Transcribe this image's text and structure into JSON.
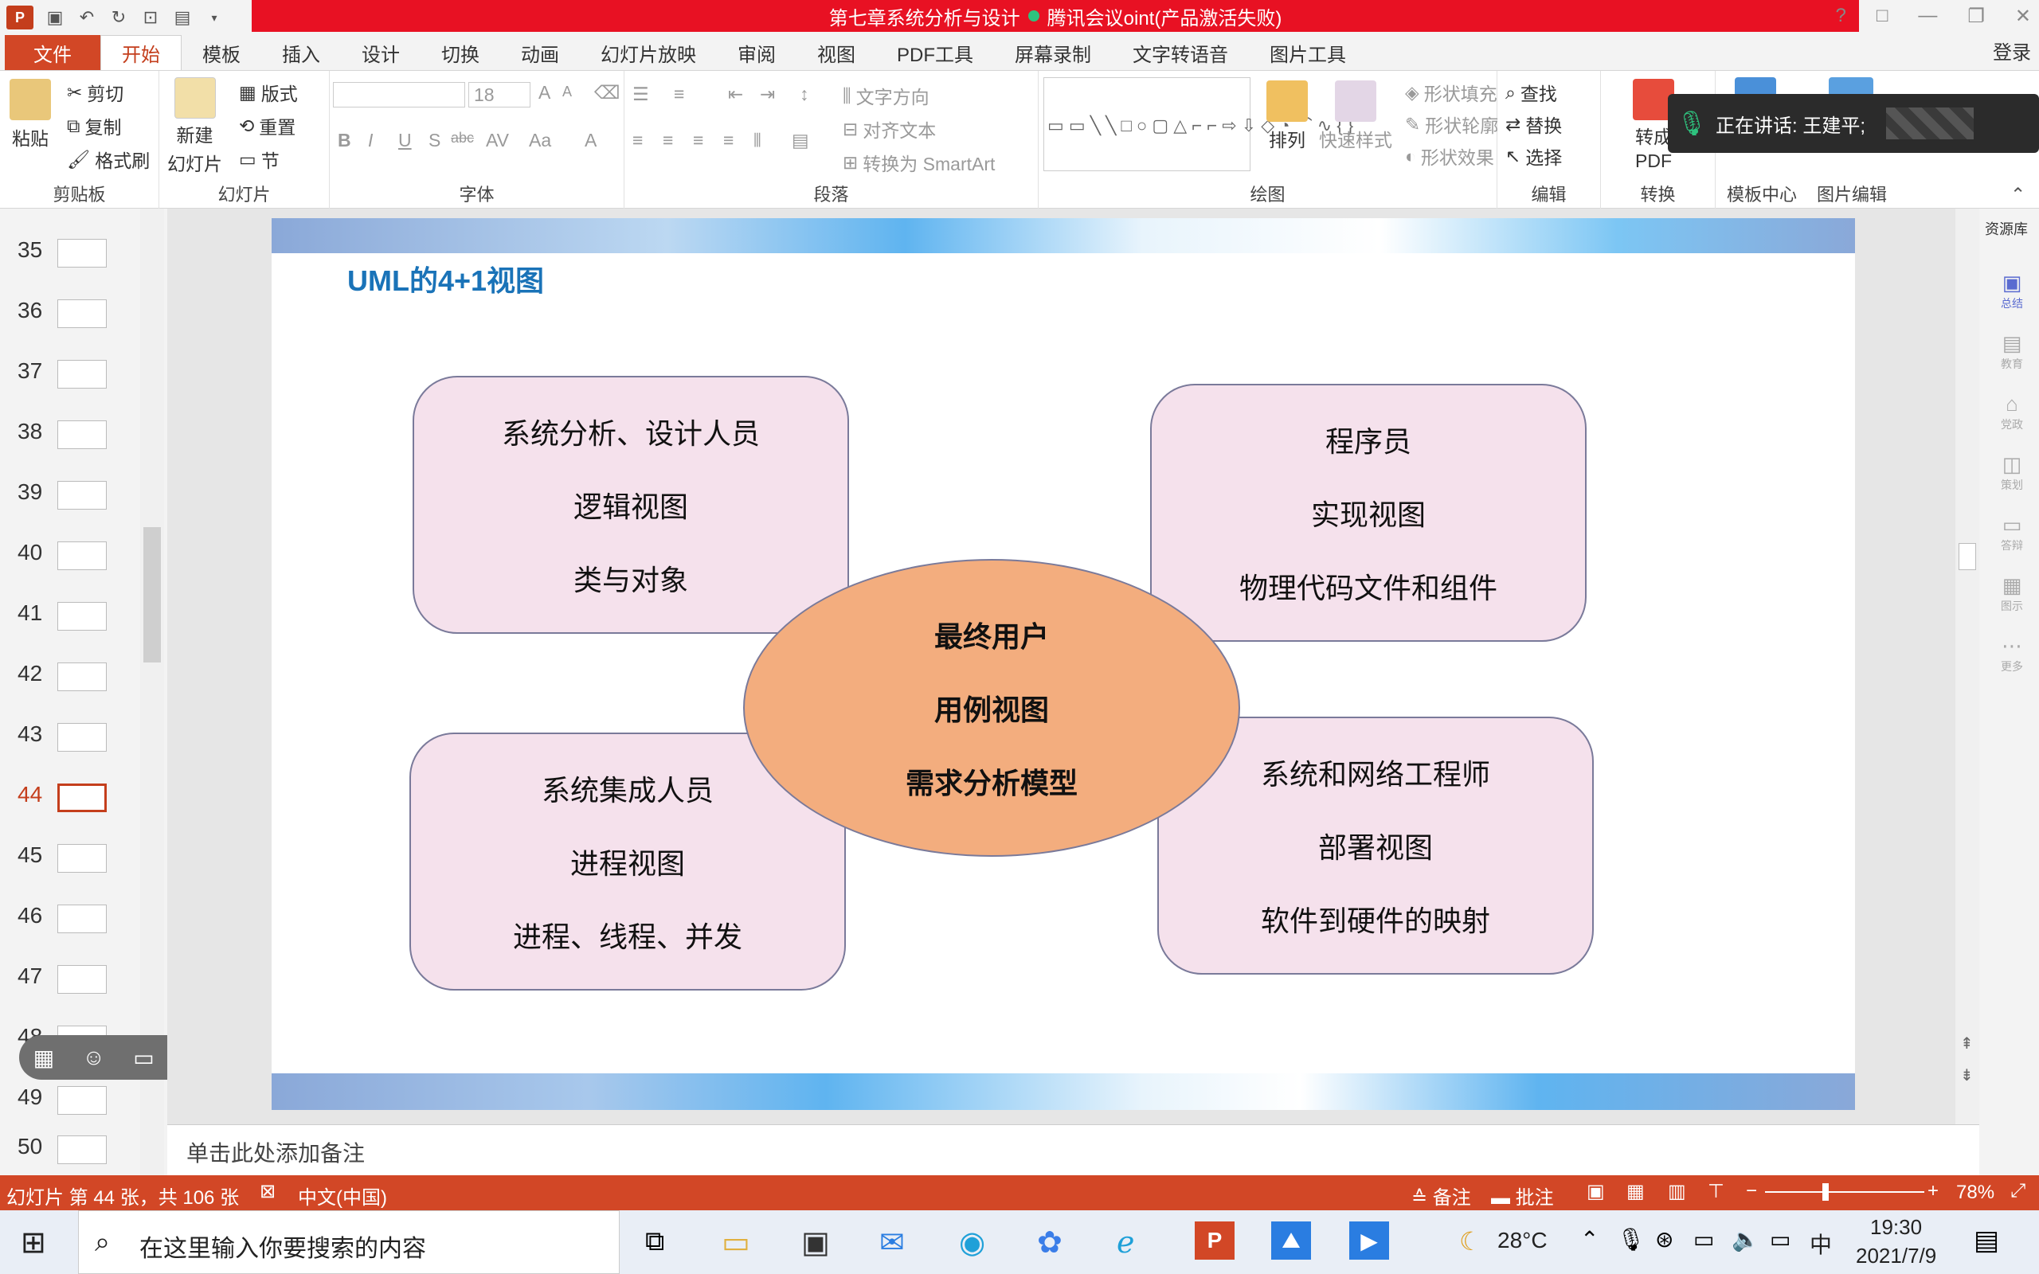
{
  "window": {
    "title": "第七章系统分析与设计",
    "title_overlay": "腾讯会议",
    "title_rest": "oint(产品激活失败)",
    "controls": [
      "?",
      "□",
      "—",
      "❐",
      "✕"
    ]
  },
  "menu": {
    "tabs": [
      "文件",
      "开始",
      "模板",
      "插入",
      "设计",
      "切换",
      "动画",
      "幻灯片放映",
      "审阅",
      "视图",
      "PDF工具",
      "屏幕录制",
      "文字转语音",
      "图片工具"
    ],
    "active": "开始",
    "login": "登录"
  },
  "ribbon": {
    "clipboard": {
      "label": "剪贴板",
      "paste": "粘贴",
      "cut": "剪切",
      "copy": "复制",
      "format_painter": "格式刷"
    },
    "slides": {
      "label": "幻灯片",
      "new_slide_1": "新建",
      "new_slide_2": "幻灯片",
      "layout": "版式",
      "reset": "重置",
      "section": "节"
    },
    "font": {
      "label": "字体",
      "size": "18",
      "bold": "B",
      "italic": "I",
      "underline": "U",
      "shadow": "S",
      "strike": "abc",
      "spacing": "AV",
      "case": "Aa",
      "grow": "A",
      "shrink": "A",
      "color": "A"
    },
    "paragraph": {
      "label": "段落",
      "text_direction": "文字方向",
      "align_text": "对齐文本",
      "smartart": "转换为 SmartArt"
    },
    "drawing": {
      "label": "绘图",
      "arrange": "排列",
      "quick_styles": "快速样式",
      "shape_fill": "形状填充",
      "shape_outline": "形状轮廓",
      "shape_effects": "形状效果"
    },
    "editing": {
      "label": "编辑",
      "find": "查找",
      "replace": "替换",
      "select": "选择"
    },
    "convert": {
      "label": "转换",
      "to_pdf_1": "转成",
      "to_pdf_2": "PDF"
    },
    "template_center": "模板中心",
    "image_edit": "图片编辑"
  },
  "meeting": {
    "speaking": "正在讲话: 王建平;"
  },
  "slides_panel": {
    "numbers": [
      "35",
      "36",
      "37",
      "38",
      "39",
      "40",
      "41",
      "42",
      "43",
      "44",
      "45",
      "46",
      "47",
      "48",
      "49",
      "50"
    ],
    "active": "44"
  },
  "right_panel": {
    "label": "资源库",
    "items": [
      "总结",
      "教育",
      "党政",
      "策划",
      "答辩",
      "图示",
      "更多"
    ]
  },
  "slide": {
    "title": "UML的4+1视图",
    "top_left": [
      "系统分析、设计人员",
      "逻辑视图",
      "类与对象"
    ],
    "top_right": [
      "程序员",
      "实现视图",
      "物理代码文件和组件"
    ],
    "bottom_left": [
      "系统集成人员",
      "进程视图",
      "进程、线程、并发"
    ],
    "bottom_right": [
      "系统和网络工程师",
      "部署视图",
      "软件到硬件的映射"
    ],
    "center": [
      "最终用户",
      "用例视图",
      "需求分析模型"
    ]
  },
  "notes": {
    "placeholder": "单击此处添加备注"
  },
  "status": {
    "slide_info": "幻灯片 第 44 张，共 106 张",
    "language": "中文(中国)",
    "notes_btn": "备注",
    "comments_btn": "批注",
    "zoom": "78%"
  },
  "taskbar": {
    "search_placeholder": "在这里输入你要搜索的内容",
    "weather": "28°C",
    "ime": "中",
    "time": "19:30",
    "date": "2021/7/9"
  },
  "colors": {
    "accent": "#d24726",
    "title_red": "#e81123",
    "slide_title": "#1a73b8",
    "box_fill": "#f5e1ec",
    "ellipse_fill": "#f3ad7e"
  }
}
